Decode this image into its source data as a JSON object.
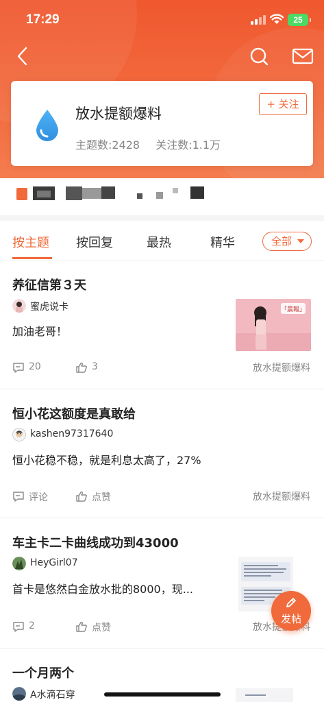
{
  "status_bar": {
    "time": "17:29",
    "battery": "25"
  },
  "forum": {
    "title": "放水提额爆料",
    "topics_label": "主题数:2428",
    "followers_label": "关注数:1.1万",
    "follow_button": "+ 关注"
  },
  "tabs": {
    "items": [
      "按主题",
      "按回复",
      "最热",
      "精华"
    ],
    "active": "按主题",
    "filter": "全部"
  },
  "posts": [
    {
      "title": "养征信第３天",
      "author": "蜜虎说卡",
      "body": "加油老哥！",
      "comments": "20",
      "likes": "3",
      "forum": "放水提额爆料",
      "thumb_label": "「晨報」"
    },
    {
      "title": "恒小花这额度是真敢给",
      "author": "kashen97317640",
      "body": "恒小花稳不稳，就是利息太高了，27%",
      "comments": "评论",
      "likes": "点赞",
      "forum": "放水提额爆料"
    },
    {
      "title": "车主卡二卡曲线成功到43000",
      "author": "HeyGirl07",
      "body": "首卡是悠然白金放水批的8000，现...",
      "comments": "2",
      "likes": "点赞",
      "forum": "放水提额爆料"
    },
    {
      "title": "一个月两个",
      "author": "A水滴石穿"
    }
  ],
  "fab": {
    "label": "发帖"
  },
  "colors": {
    "accent": "#f06a3b",
    "hero": "#f0582f"
  }
}
